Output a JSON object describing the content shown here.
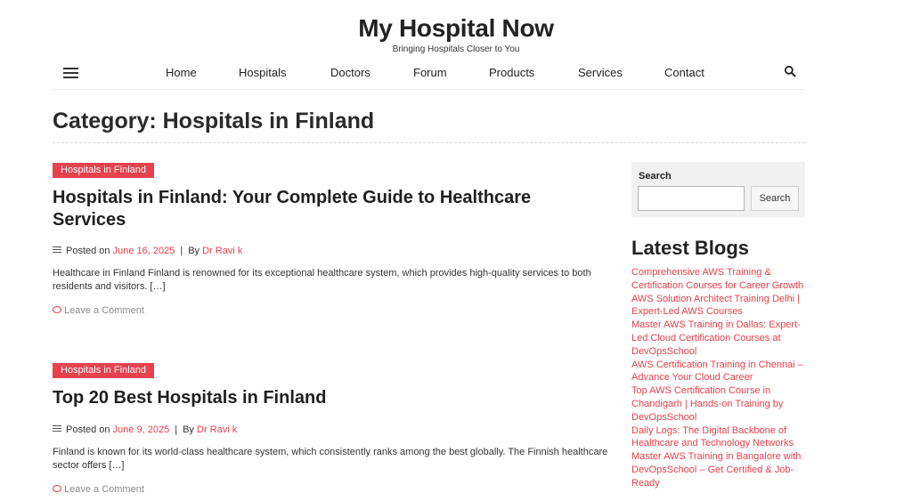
{
  "site": {
    "title": "My Hospital Now",
    "tagline": "Bringing Hospitals Closer to You"
  },
  "nav": {
    "menu_icon": "hamburger-icon",
    "search_icon": "search-icon",
    "items": [
      {
        "label": "Home"
      },
      {
        "label": "Hospitals"
      },
      {
        "label": "Doctors"
      },
      {
        "label": "Forum"
      },
      {
        "label": "Products"
      },
      {
        "label": "Services"
      },
      {
        "label": "Contact"
      }
    ]
  },
  "page": {
    "title": "Category: Hospitals in Finland"
  },
  "posts": [
    {
      "category": "Hospitals in Finland",
      "title": "Hospitals in Finland: Your Complete Guide to Healthcare Services",
      "posted_on": "Posted on",
      "date": "June 16, 2025",
      "separator": "|",
      "by": "By",
      "author": "Dr Ravi k",
      "excerpt": "Healthcare in Finland Finland is renowned for its exceptional healthcare system, which provides high-quality services to both residents and visitors. […]",
      "comment_label": "Leave a Comment"
    },
    {
      "category": "Hospitals in Finland",
      "title": "Top 20 Best Hospitals in Finland",
      "posted_on": "Posted on",
      "date": "June 9, 2025",
      "separator": "|",
      "by": "By",
      "author": "Dr Ravi k",
      "excerpt": "Finland is known for its world-class healthcare system, which consistently ranks among the best globally. The Finnish healthcare sector offers […]",
      "comment_label": "Leave a Comment"
    }
  ],
  "sidebar": {
    "search": {
      "label": "Search",
      "value": "",
      "button_label": "Search"
    },
    "latest_heading": "Latest Blogs",
    "latest_blogs": [
      "Comprehensive AWS Training & Certification Courses for Career Growth",
      "AWS Solution Architect Training Delhi | Expert-Led AWS Courses",
      "Master AWS Training in Dallas: Expert-Led Cloud Certification Courses at DevOpsSchool",
      "AWS Certification Training in Chennai – Advance Your Cloud Career",
      "Top AWS Certification Course in Chandigarh | Hands-on Training by DevOpsSchool",
      "Daily Logs: The Digital Backbone of Healthcare and Technology Networks",
      "Master AWS Training in Bangalore with DevOpsSchool – Get Certified & Job-Ready"
    ]
  },
  "colors": {
    "accent": "#e5424d",
    "text": "#2b2b2b",
    "widget_bg": "#f1f1f1"
  }
}
